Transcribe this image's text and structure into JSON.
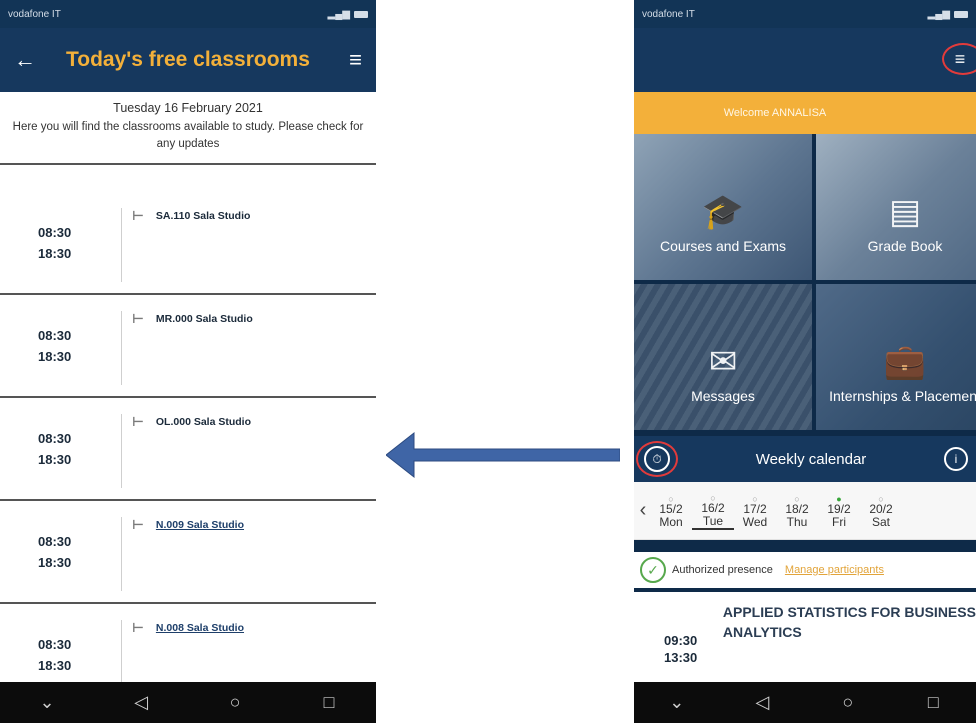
{
  "left_phone": {
    "header": {
      "back_icon": "arrow-left-icon",
      "title": "Today's free classrooms",
      "menu_icon": "hamburger-icon"
    },
    "info": {
      "date": "Tuesday 16 February 2021",
      "note": "Here you will find the classrooms available to study. Please check for any updates"
    },
    "slots": [
      {
        "start": "08:30",
        "end": "18:30",
        "room": "SA.110 Sala Studio",
        "link": false
      },
      {
        "start": "08:30",
        "end": "18:30",
        "room": "MR.000 Sala Studio",
        "link": false
      },
      {
        "start": "08:30",
        "end": "18:30",
        "room": "OL.000 Sala Studio",
        "link": false
      },
      {
        "start": "08:30",
        "end": "18:30",
        "room": "N.009 Sala Studio",
        "link": true
      },
      {
        "start": "08:30",
        "end": "18:30",
        "room": "N.008 Sala Studio",
        "link": true
      }
    ]
  },
  "arrow": {
    "color": "#3f65a6",
    "direction": "left"
  },
  "right_phone": {
    "welcome": "Welcome ANNALISA",
    "tiles": [
      {
        "label": "Courses and Exams",
        "icon": "graduation-cap-icon"
      },
      {
        "label": "Grade Book",
        "icon": "notebook-icon"
      },
      {
        "label": "Messages",
        "icon": "chat-icon"
      },
      {
        "label": "Internships & Placement",
        "icon": "briefcase-icon"
      }
    ],
    "weekly": {
      "title": "Weekly calendar",
      "left_icon": "clock-calendar-icon",
      "right_icon": "info-icon"
    },
    "days": [
      {
        "date": "15/2",
        "name": "Mon",
        "selected": false,
        "dot": "grey"
      },
      {
        "date": "16/2",
        "name": "Tue",
        "selected": true,
        "dot": "grey"
      },
      {
        "date": "17/2",
        "name": "Wed",
        "selected": false,
        "dot": "grey"
      },
      {
        "date": "18/2",
        "name": "Thu",
        "selected": false,
        "dot": "grey"
      },
      {
        "date": "19/2",
        "name": "Fri",
        "selected": false,
        "dot": "green"
      },
      {
        "date": "20/2",
        "name": "Sat",
        "selected": false,
        "dot": "grey"
      }
    ],
    "presence": {
      "label": "Authorized presence",
      "manage": "Manage participants"
    },
    "lesson": {
      "start": "09:30",
      "end": "13:30",
      "title": "APPLIED STATISTICS FOR BUSINESS ANALYTICS"
    }
  },
  "colors": {
    "navy": "#16385e",
    "orange": "#f3b03a",
    "red_highlight": "#e23b3b",
    "green": "#38a63a"
  }
}
